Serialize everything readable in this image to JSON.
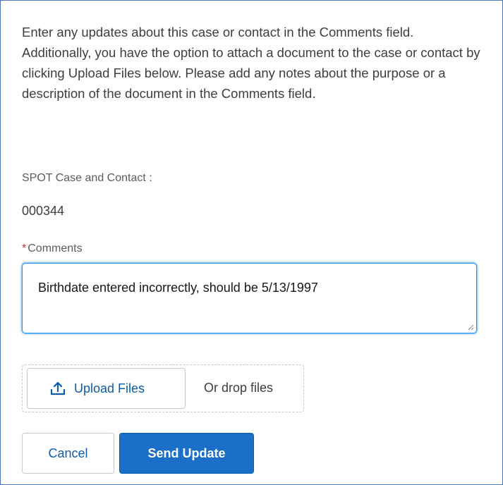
{
  "intro": {
    "text": "Enter any updates about this case or contact in the Comments field. Additionally, you have the option to attach a document to the case or contact by clicking Upload Files below. Please add any notes about the purpose or a description of the document in the Comments field."
  },
  "case_field": {
    "label": "SPOT Case and Contact :",
    "value": "000344"
  },
  "comments": {
    "required_marker": "*",
    "label": "Comments",
    "value": "Birthdate entered incorrectly, should be 5/13/1997"
  },
  "upload": {
    "button_label": "Upload Files",
    "icon": "upload-icon",
    "drop_text": "Or drop files"
  },
  "actions": {
    "cancel_label": "Cancel",
    "send_label": "Send Update"
  },
  "colors": {
    "border": "#4a74b8",
    "link": "#0b5cab",
    "primary": "#1b6fc8",
    "required": "#c23934",
    "focus": "#1b96ff"
  }
}
